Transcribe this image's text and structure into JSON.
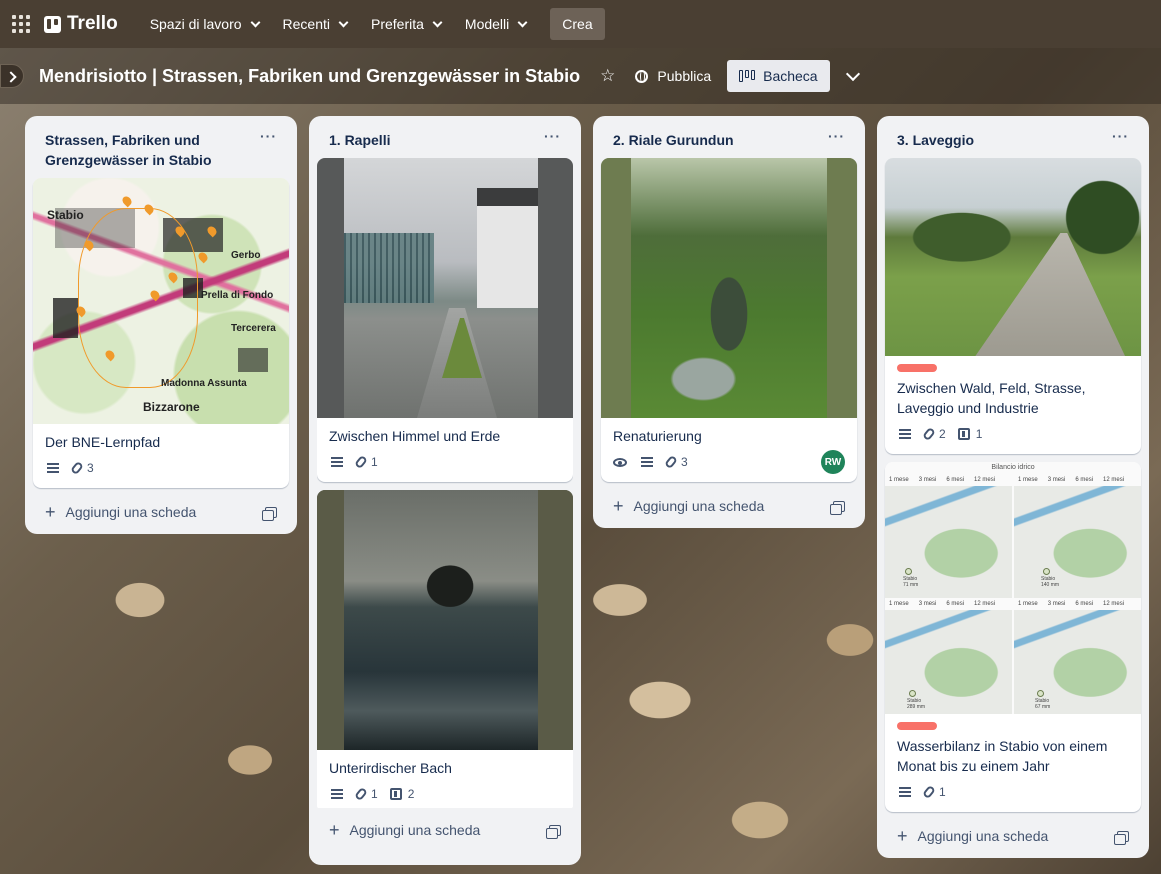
{
  "nav": {
    "logo": "Trello",
    "items": [
      {
        "label": "Spazi di lavoro"
      },
      {
        "label": "Recenti"
      },
      {
        "label": "Preferita"
      },
      {
        "label": "Modelli"
      }
    ],
    "create_label": "Crea"
  },
  "board": {
    "title": "Mendrisiotto | Strassen, Fabriken und Grenzgewässer in Stabio",
    "visibility": "Pubblica",
    "view_label": "Bacheca"
  },
  "add_card_label": "Aggiungi una scheda",
  "lists": [
    {
      "title": "Strassen, Fabriken und Grenzgewässer in Stabio",
      "cards": [
        {
          "title": "Der BNE-Lernpfad",
          "attachments": "3",
          "map_labels": [
            "Stabio",
            "Gerbo",
            "Prella di Fondo",
            "Madonna Assunta",
            "Bizzarone",
            "Tercerera"
          ]
        }
      ]
    },
    {
      "title": "1. Rapelli",
      "cards": [
        {
          "title": "Zwischen Himmel und Erde",
          "attachments": "1"
        },
        {
          "title": "Unterirdischer Bach",
          "attachments": "1",
          "checklist": "2"
        }
      ]
    },
    {
      "title": "2. Riale Gurundun",
      "cards": [
        {
          "title": "Renaturierung",
          "attachments": "3",
          "member": "RW"
        }
      ]
    },
    {
      "title": "3. Laveggio",
      "cards": [
        {
          "title": "Zwischen Wald, Feld, Strasse, Laveggio und Industrie",
          "attachments": "2",
          "checklist": "1"
        },
        {
          "title": "Wasserbilanz in Stabio von einem Monat bis zu einem Jahr",
          "attachments": "1",
          "cover_header": "Bilancio idrico",
          "cover_tabs": [
            "1 mese",
            "3 mesi",
            "6 mesi",
            "12 mesi"
          ],
          "cover_places": [
            "Stabio",
            "Stabio",
            "Stabio",
            "Stabio"
          ],
          "cover_values": [
            "71 mm",
            "140 mm",
            "289 mm",
            "67 mm"
          ]
        }
      ]
    }
  ],
  "colors": {
    "label_red": "#f87168",
    "avatar_green": "#1f845a",
    "topbar": "#4a3f33"
  }
}
